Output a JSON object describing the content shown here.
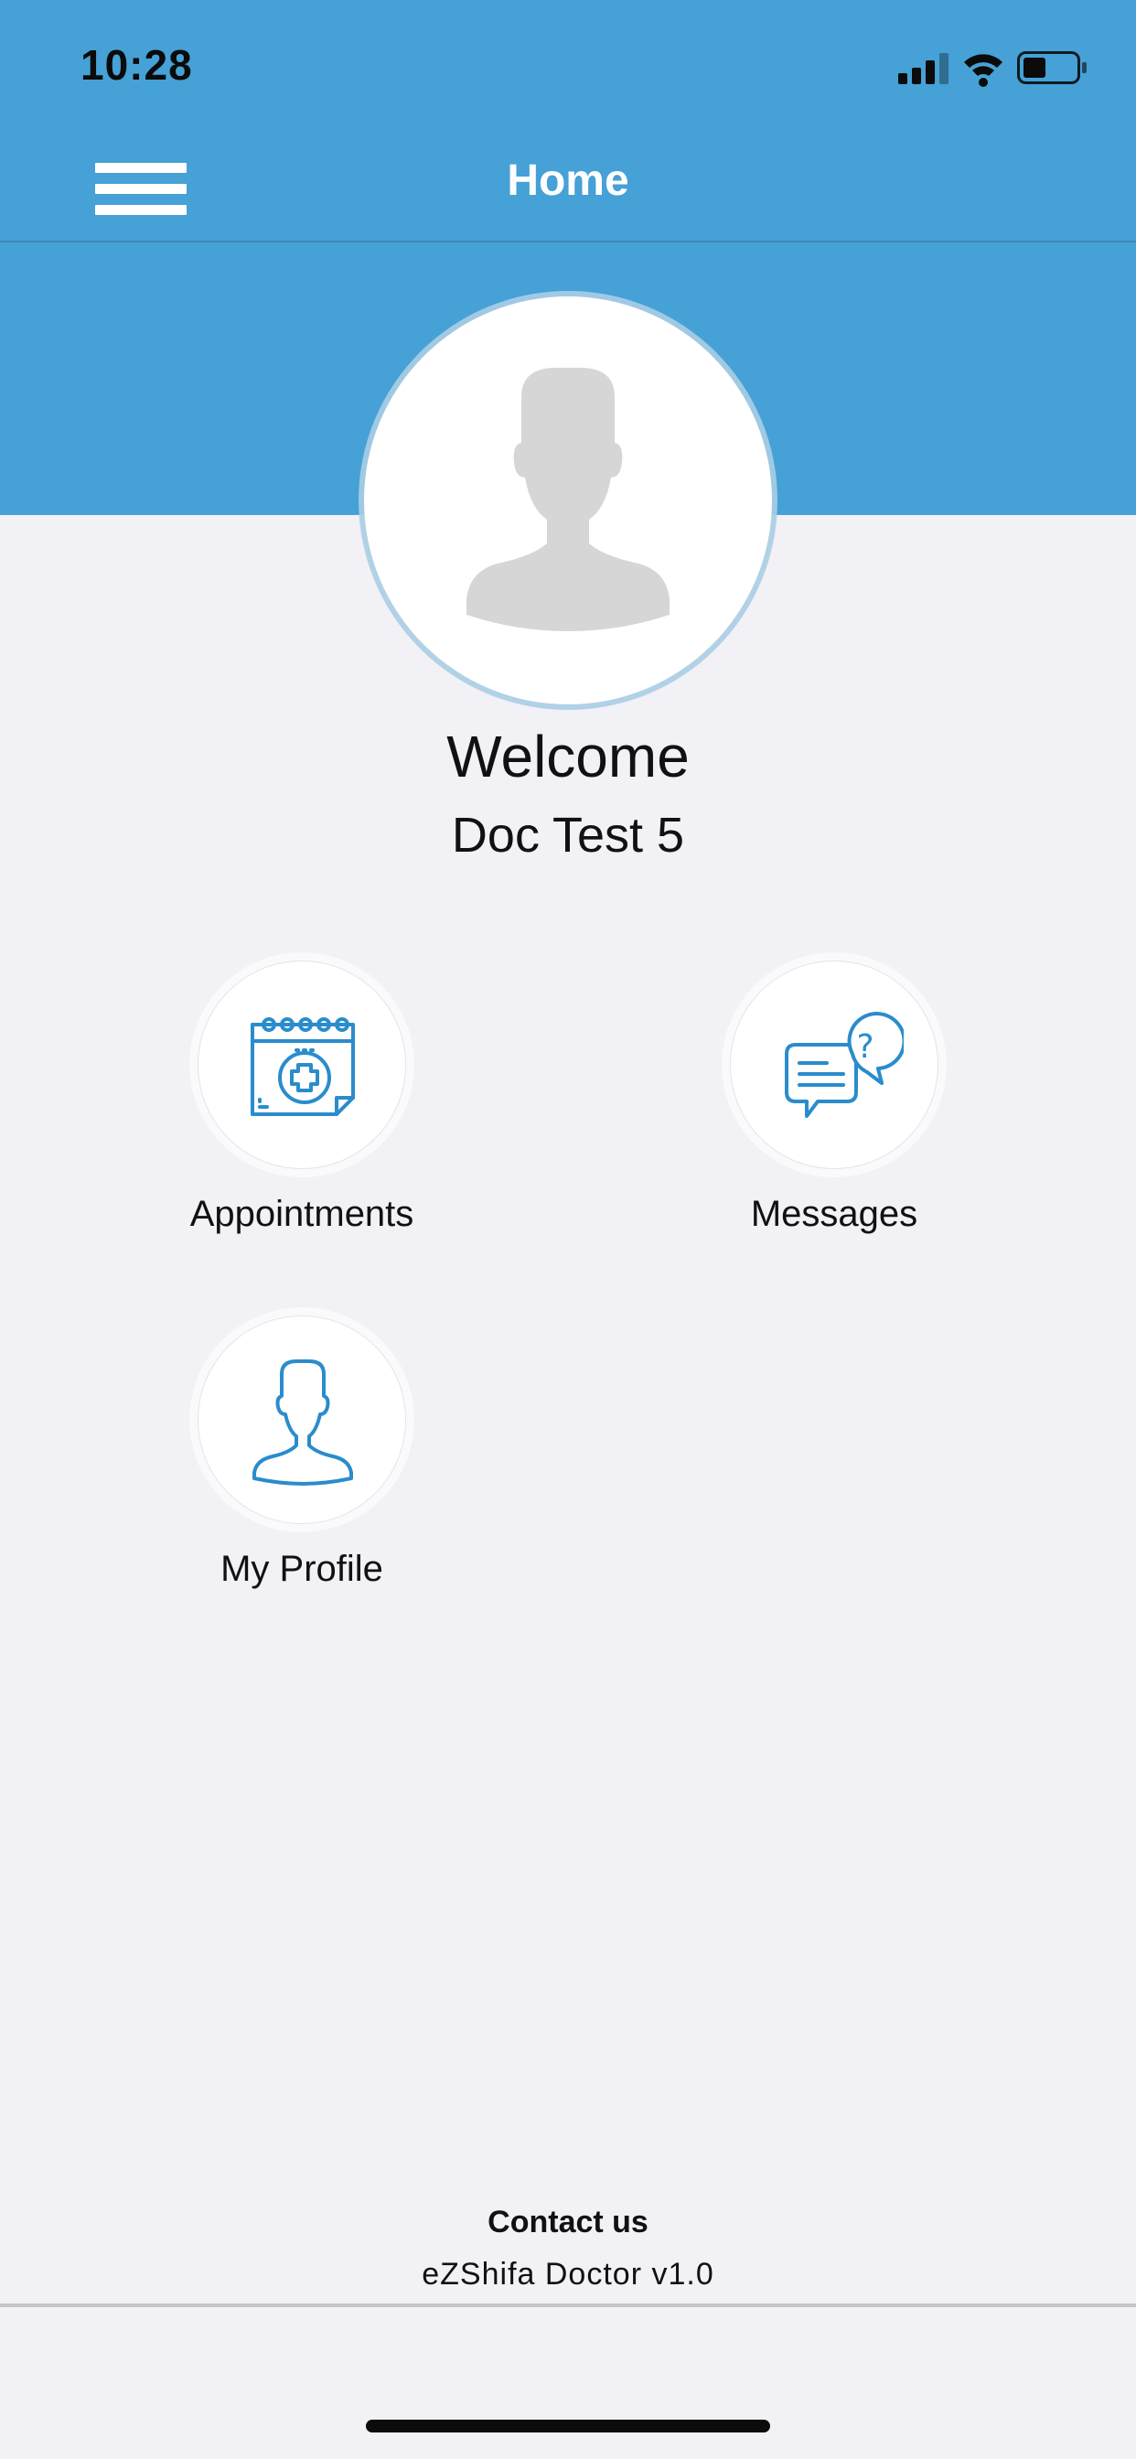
{
  "status_bar": {
    "time": "10:28",
    "icons": [
      "cellular-signal-icon",
      "wifi-icon",
      "battery-icon"
    ]
  },
  "nav": {
    "title": "Home",
    "menu_icon": "hamburger-menu-icon"
  },
  "profile": {
    "avatar_icon": "user-silhouette-icon",
    "welcome": "Welcome",
    "name": "Doc Test 5"
  },
  "tiles": [
    {
      "label": "Appointments",
      "icon": "calendar-medical-icon"
    },
    {
      "label": "Messages",
      "icon": "chat-question-icon"
    },
    {
      "label": "My Profile",
      "icon": "person-outline-icon"
    }
  ],
  "footer": {
    "contact": "Contact us",
    "version": "eZShifa Doctor v1.0"
  },
  "colors": {
    "header": "#45a1d6",
    "background": "#f1f1f6",
    "icon_accent": "#2a8ccc",
    "avatar_silhouette": "#d6d6d6"
  }
}
